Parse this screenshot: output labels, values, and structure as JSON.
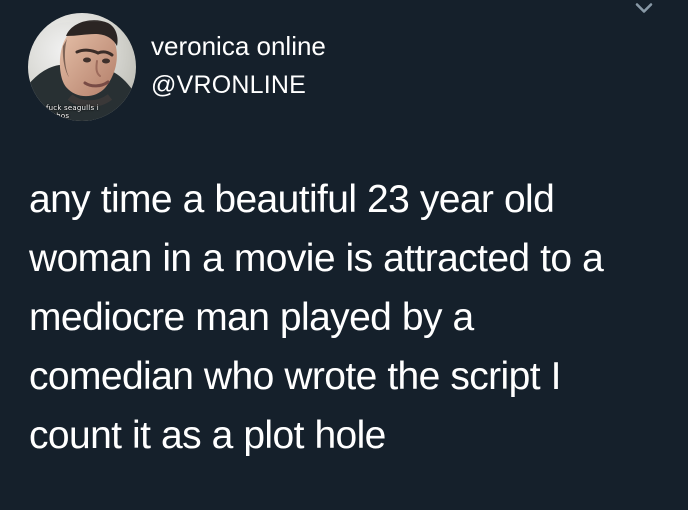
{
  "tweet": {
    "display_name": "veronica online",
    "handle": "@VRONLINE",
    "avatar_caption_line1": "fuck seagulls i",
    "avatar_caption_line2": "...thos",
    "text_lines": [
      "any time a beautiful 23 year old",
      "woman in a movie is attracted to a",
      "mediocre man played by a",
      "comedian who wrote the script I",
      "count it as a plot hole"
    ]
  },
  "colors": {
    "background": "#15202b",
    "text": "#ffffff",
    "chevron": "#8899a6"
  },
  "icons": {
    "menu": "chevron-down-icon",
    "avatar": "profile-photo"
  }
}
